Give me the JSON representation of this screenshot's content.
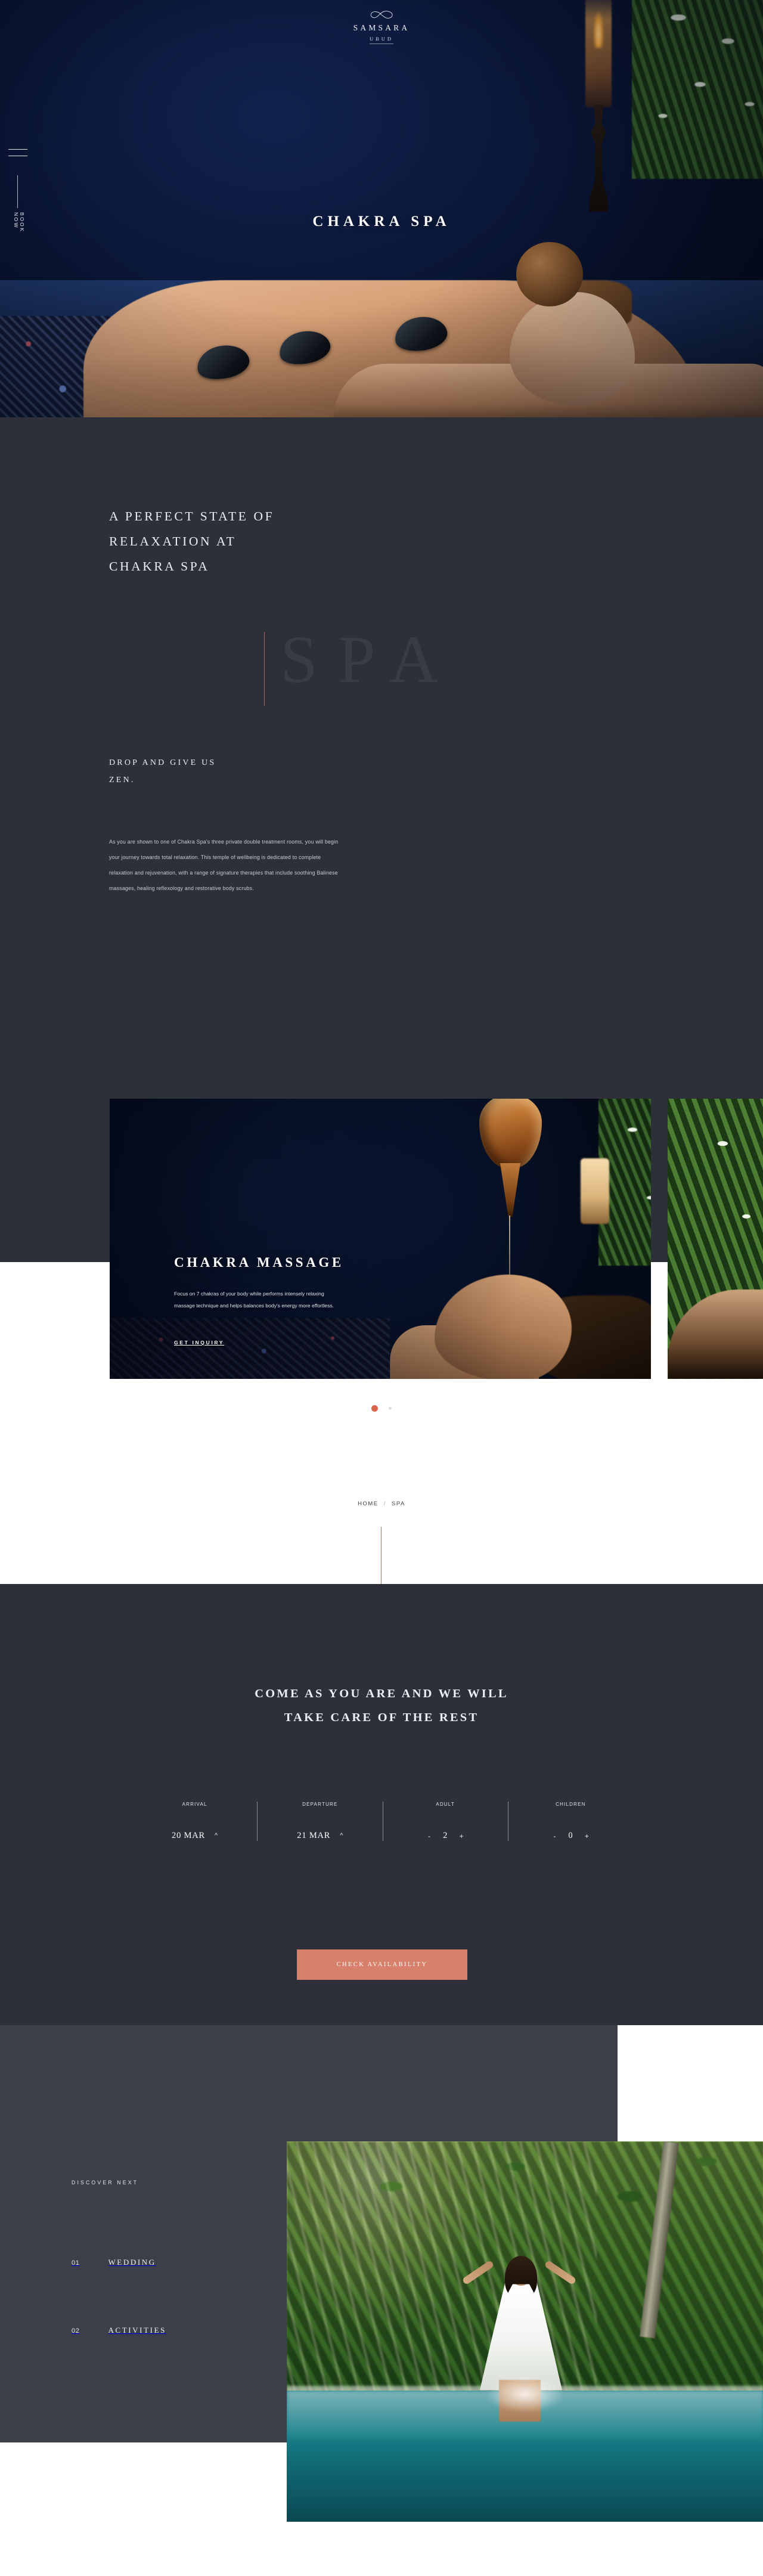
{
  "brand": {
    "name": "SAMSARA",
    "sub": "UBUD",
    "mark_icon": "infinity-icon"
  },
  "rail": {
    "menu_icon": "hamburger-menu-icon",
    "book_now": "BOOK NOW"
  },
  "hero": {
    "title": "CHAKRA SPA"
  },
  "intro": {
    "heading_line1": "A PERFECT STATE OF",
    "heading_line2": "RELAXATION AT",
    "heading_line3": "CHAKRA SPA",
    "ghost_word": "SPA",
    "sub_line1": "DROP AND GIVE US",
    "sub_line2": "ZEN.",
    "body": "As you are shown to one of Chakra Spa's three private double treatment rooms, you will begin your journey towards total relaxation. This temple of wellbeing is dedicated to complete relaxation and rejuvenation, with a range of signature therapies that include soothing Balinese massages, healing reflexology and restorative body scrubs."
  },
  "carousel": {
    "cards": [
      {
        "title": "CHAKRA MASSAGE",
        "description": "Focus on 7 chakras of your body while performs intensely relaxing massage technique and helps balances body's energy more effortless.",
        "cta": "GET INQUIRY"
      },
      {
        "title": "",
        "description": "",
        "cta": ""
      }
    ],
    "active_index": 0,
    "dot_count": 2
  },
  "breadcrumb": {
    "home": "HOME",
    "separator": "/",
    "current": "SPA"
  },
  "booking": {
    "heading_line1": "COME AS YOU ARE AND WE WILL",
    "heading_line2": "TAKE CARE OF THE REST",
    "fields": [
      {
        "label": "ARRIVAL",
        "value": "20 MAR",
        "control": "chevron-up-icon"
      },
      {
        "label": "DEPARTURE",
        "value": "21 MAR",
        "control": "chevron-up-icon"
      },
      {
        "label": "ADULT",
        "value": "2",
        "minus": "-",
        "plus": "+"
      },
      {
        "label": "CHILDREN",
        "value": "0",
        "minus": "-",
        "plus": "+"
      }
    ],
    "submit_label": "CHECK AVAILABILITY"
  },
  "discover": {
    "label": "DISCOVER NEXT",
    "items": [
      {
        "num": "01",
        "name": "WEDDING"
      },
      {
        "num": "02",
        "name": "ACTIVITIES"
      }
    ]
  },
  "colors": {
    "dark_panel": "#2e3039",
    "dark_panel_alt": "#3c3e49",
    "accent": "#d7816c",
    "accent_line": "#b4705c",
    "hero_navy": "#0b1738",
    "text_light": "#eceef3",
    "text_muted": "#c8ccd6"
  }
}
